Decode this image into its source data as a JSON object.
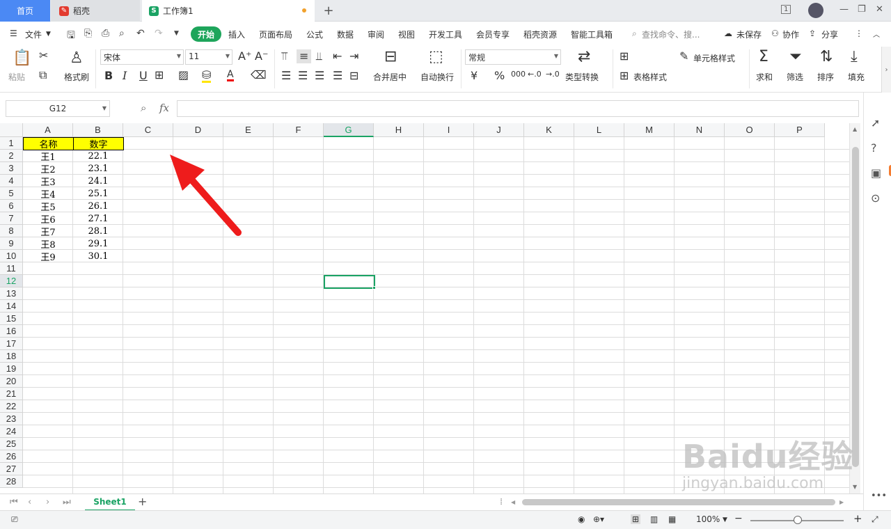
{
  "tabs": {
    "home": "首页",
    "daoke": "稻壳",
    "workbook": "工作簿1",
    "new_tab": "+",
    "page_count": "1"
  },
  "menubar": {
    "file": "文件",
    "start": "开始",
    "items": [
      "插入",
      "页面布局",
      "公式",
      "数据",
      "审阅",
      "视图",
      "开发工具",
      "会员专享",
      "稻壳资源",
      "智能工具箱"
    ],
    "search_placeholder": "查找命令、搜...",
    "unsaved": "未保存",
    "collab": "协作",
    "share": "分享"
  },
  "ribbon": {
    "paste": "粘贴",
    "format_painter": "格式刷",
    "font_name": "宋体",
    "font_size": "11",
    "merge_center": "合并居中",
    "wrap_text": "自动换行",
    "number_format": "常规",
    "type_convert": "类型转换",
    "cell_style": "单元格样式",
    "table_style": "表格样式",
    "sum": "求和",
    "filter": "筛选",
    "sort": "排序",
    "fill": "填充",
    "bold": "B",
    "italic": "I",
    "underline": "U",
    "font_color": "A",
    "currency": "¥",
    "percent": "%",
    "thousands": "000"
  },
  "formula_bar": {
    "name_box": "G12",
    "fx": "fx",
    "value": ""
  },
  "grid": {
    "columns": [
      "A",
      "B",
      "C",
      "D",
      "E",
      "F",
      "G",
      "H",
      "I",
      "J",
      "K",
      "L",
      "M",
      "N",
      "O",
      "P"
    ],
    "selected_column": "G",
    "selected_row": "12",
    "rows": [
      "1",
      "2",
      "3",
      "4",
      "5",
      "6",
      "7",
      "8",
      "9",
      "10",
      "11",
      "12",
      "13",
      "14",
      "15",
      "16",
      "17",
      "18",
      "19",
      "20",
      "21",
      "22",
      "23",
      "24",
      "25",
      "26",
      "27",
      "28"
    ],
    "header": [
      "名称",
      "数字"
    ],
    "data": [
      [
        "王1",
        "22.1"
      ],
      [
        "王2",
        "23.1"
      ],
      [
        "王3",
        "24.1"
      ],
      [
        "王4",
        "25.1"
      ],
      [
        "王5",
        "26.1"
      ],
      [
        "王6",
        "27.1"
      ],
      [
        "王7",
        "28.1"
      ],
      [
        "王8",
        "29.1"
      ],
      [
        "王9",
        "30.1"
      ]
    ],
    "header_fill": "#ffff00"
  },
  "sheetbar": {
    "sheet": "Sheet1",
    "add": "+"
  },
  "statusbar": {
    "zoom": "100%",
    "minus": "−",
    "plus": "+"
  },
  "watermark": {
    "brand": "Baidu经验",
    "url": "jingyan.baidu.com"
  },
  "colors": {
    "accent": "#1aa364",
    "home_tab": "#4b89f4",
    "arrow": "#ee1c1c"
  }
}
